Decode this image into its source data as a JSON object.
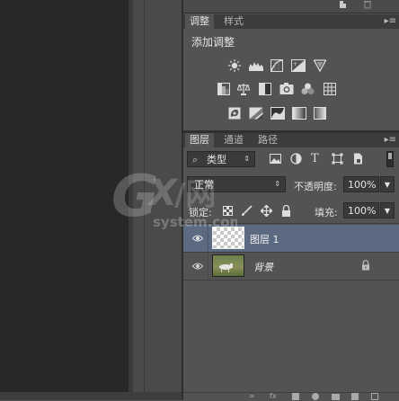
{
  "adjustments_panel": {
    "tabs": [
      "调整",
      "样式"
    ],
    "title": "添加调整",
    "icons": [
      [
        "brightness-contrast-icon",
        "levels-icon",
        "curves-icon",
        "exposure-icon",
        "vibrance-icon"
      ],
      [
        "hue-saturation-icon",
        "color-balance-icon",
        "black-white-icon",
        "photo-filter-icon",
        "channel-mixer-icon",
        "color-lookup-icon"
      ],
      [
        "invert-icon",
        "posterize-icon",
        "threshold-icon",
        "gradient-map-icon",
        "selective-color-icon"
      ]
    ]
  },
  "layers_panel": {
    "tabs": [
      "图层",
      "通道",
      "路径"
    ],
    "filter": {
      "search_glyph": "⌕",
      "kind_label": "类型",
      "icons": [
        "pixel-filter-icon",
        "adjustment-filter-icon",
        "type-filter-icon",
        "shape-filter-icon",
        "smart-object-filter-icon"
      ]
    },
    "blend_mode": "正常",
    "opacity_label": "不透明度:",
    "opacity_value": "100%",
    "lock_label": "锁定:",
    "fill_label": "填充:",
    "fill_value": "100%",
    "layers": [
      {
        "name": "图层 1",
        "selected": true,
        "thumb": "transparent",
        "locked": false
      },
      {
        "name": "背景",
        "selected": false,
        "thumb": "landscape",
        "locked": true
      }
    ]
  },
  "watermark": {
    "text": "GX/网",
    "subtext": "system.com"
  },
  "colors": {
    "panel_bg": "#535353",
    "selected_layer": "#5b6a80",
    "canvas_bg": "#282828"
  }
}
